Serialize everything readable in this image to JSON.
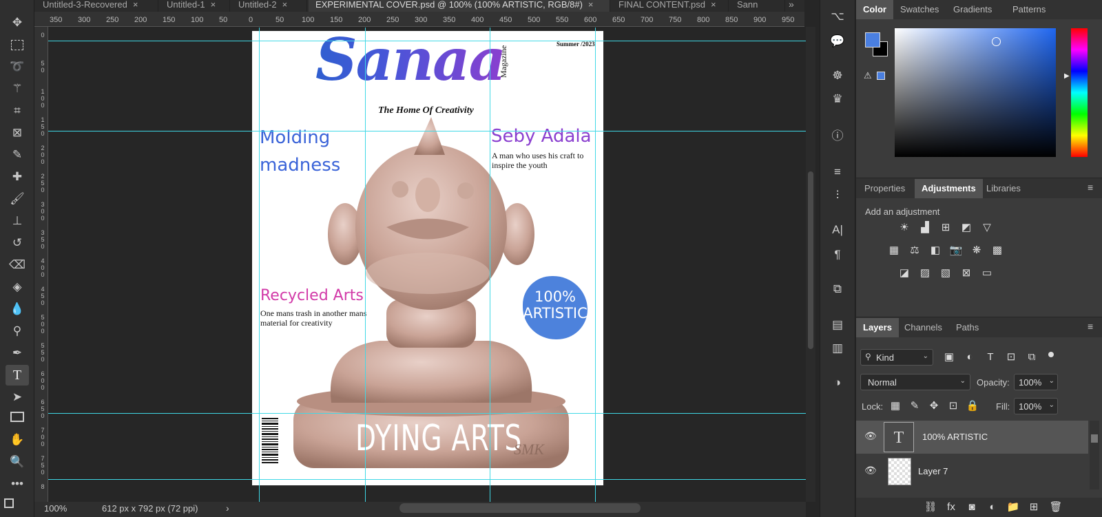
{
  "tabs": [
    {
      "label": "Untitled-3-Recovered",
      "close": "×"
    },
    {
      "label": "Untitled-1",
      "close": "×"
    },
    {
      "label": "Untitled-2",
      "close": "×"
    },
    {
      "label": "EXPERIMENTAL COVER.psd @ 100% (100% ARTISTIC, RGB/8#)",
      "close": "×"
    },
    {
      "label": "FINAL CONTENT.psd",
      "close": "×"
    },
    {
      "label": "Sann",
      "close": ""
    }
  ],
  "tab_overflow": "»",
  "ruler_h": [
    "350",
    "300",
    "250",
    "200",
    "150",
    "100",
    "50",
    "0",
    "50",
    "100",
    "150",
    "200",
    "250",
    "300",
    "350",
    "400",
    "450",
    "500",
    "550",
    "600",
    "650",
    "700",
    "750",
    "800",
    "850",
    "900",
    "950"
  ],
  "ruler_v": [
    "0",
    "5 0",
    "1 0 0",
    "1 5 0",
    "2 0 0",
    "2 5 0",
    "3 0 0",
    "3 5 0",
    "4 0 0",
    "4 5 0",
    "5 0 0",
    "5 5 0",
    "6 0 0",
    "6 5 0",
    "7 0 0",
    "7 5 0",
    "8"
  ],
  "cover": {
    "date": "Summer /2023",
    "title": "Sanaa",
    "vertical": "Magazine",
    "tagline": "The Home Of Creativity",
    "molding_line1": "Molding",
    "molding_line2": "madness",
    "seby_title": "Seby Adala",
    "seby_text": "A man who uses his craft to inspire the youth",
    "recycled_title": "Recycled Arts",
    "recycled_text": "One mans trash in another mans material for creativity",
    "badge_line1": "100%",
    "badge_line2": "ARTISTIC",
    "footer": "DYING ARTS",
    "carving": "SMK"
  },
  "status": {
    "zoom": "100%",
    "doc_info": "612 px x 792 px (72 ppi)",
    "arrow": "›"
  },
  "color_panel": {
    "tabs": [
      "Color",
      "Swatches",
      "Gradients",
      "Patterns"
    ],
    "foreground": "#4a7fe0",
    "background": "#000000"
  },
  "adjust_panel": {
    "tabs": [
      "Properties",
      "Adjustments",
      "Libraries"
    ],
    "heading": "Add an adjustment"
  },
  "layers_panel": {
    "tabs": [
      "Layers",
      "Channels",
      "Paths"
    ],
    "filter": "Kind",
    "blend": "Normal",
    "opacity_label": "Opacity:",
    "opacity": "100%",
    "lock_label": "Lock:",
    "fill_label": "Fill:",
    "fill": "100%",
    "layers": [
      {
        "name": "100% ARTISTIC",
        "type": "text-layer",
        "thumb": "T"
      },
      {
        "name": "Layer 7",
        "type": "pixel-layer",
        "thumb": ""
      }
    ]
  },
  "colors": {
    "accent_blue": "#3a63d8",
    "purple": "#8a3fcf",
    "magenta": "#d23aa8",
    "guide": "#3fd8e6",
    "badge": "#4d82dc"
  }
}
